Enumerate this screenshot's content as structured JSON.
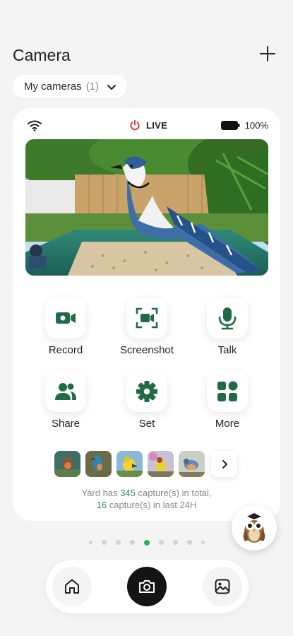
{
  "header": {
    "title": "Camera"
  },
  "selector": {
    "label": "My cameras",
    "count": "(1)"
  },
  "camera": {
    "live_label": "LIVE",
    "battery": "100%"
  },
  "actions": [
    {
      "label": "Record",
      "icon": "video-camera-icon"
    },
    {
      "label": "Screenshot",
      "icon": "screenshot-icon"
    },
    {
      "label": "Talk",
      "icon": "microphone-icon"
    },
    {
      "label": "Share",
      "icon": "people-icon"
    },
    {
      "label": "Set",
      "icon": "gear-icon"
    },
    {
      "label": "More",
      "icon": "grid-icon"
    }
  ],
  "captures": {
    "text_a": "Yard has ",
    "total": "345",
    "text_b": " capture(s) in total,",
    "recent": "16",
    "text_c": " capture(s) in last 24H"
  },
  "pager": {
    "pages": 9,
    "active": 4
  },
  "colors": {
    "accent": "#1f6b45",
    "live_red": "#e0343c",
    "active_dot": "#22b35e"
  }
}
